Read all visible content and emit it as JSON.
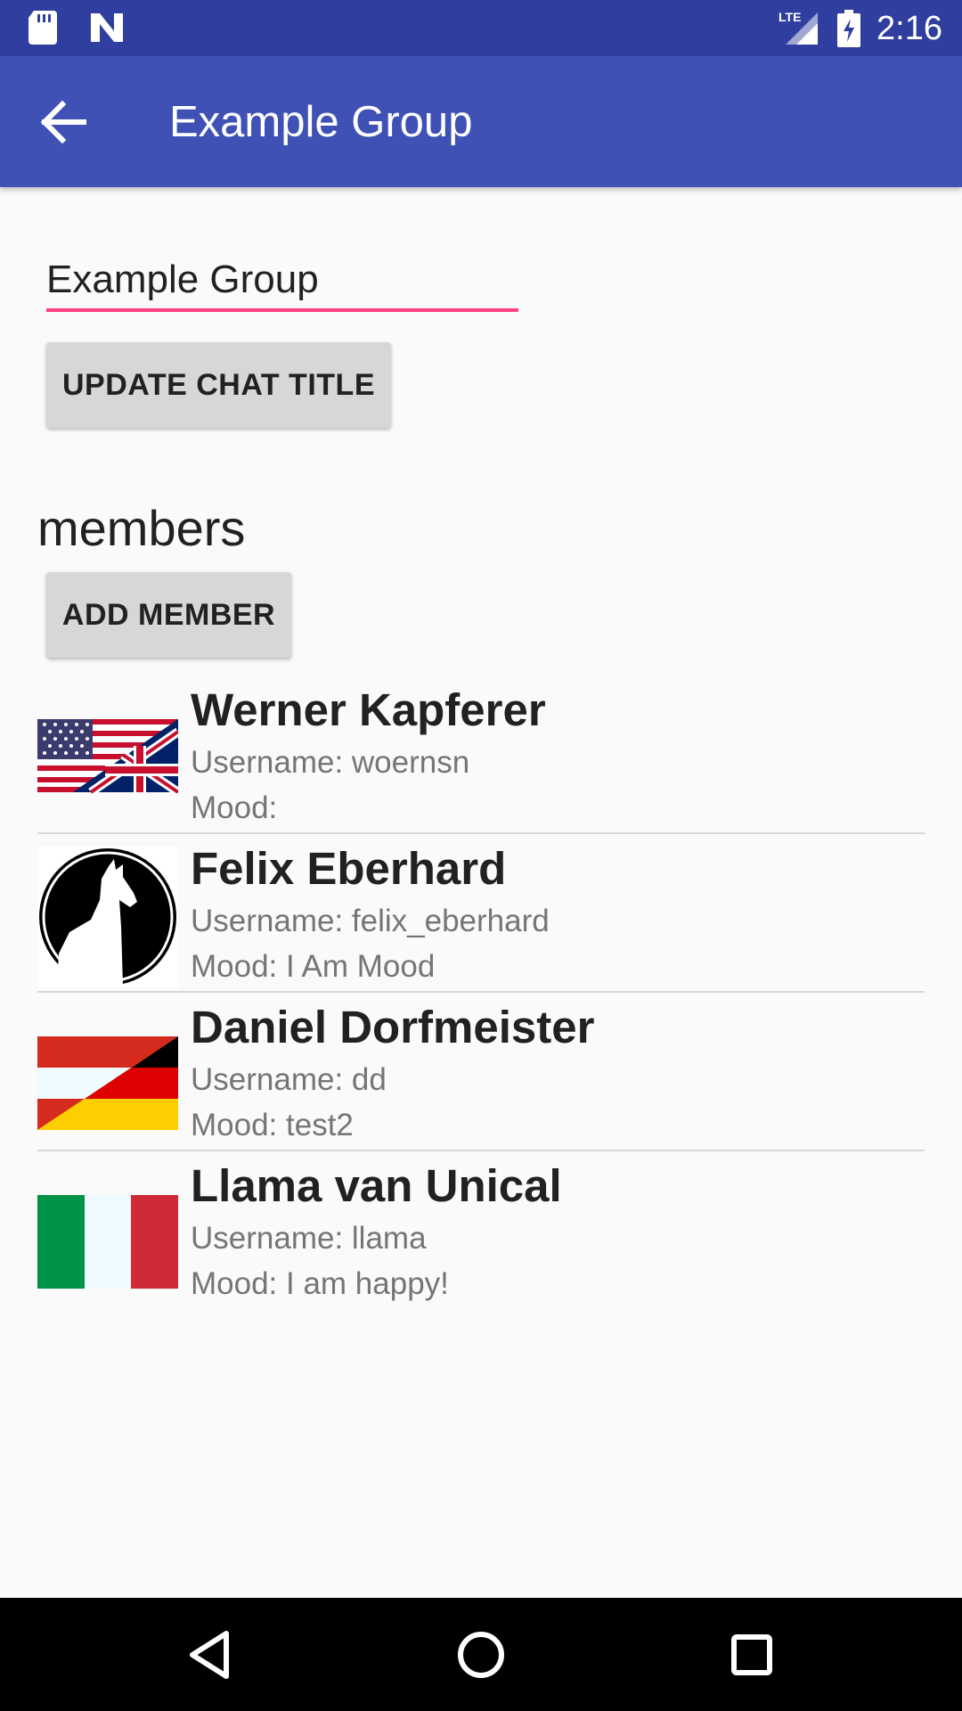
{
  "status_bar": {
    "time": "2:16",
    "network": "LTE",
    "left_icons": [
      "sd-card-icon",
      "n-logo-icon"
    ],
    "right_icons": [
      "signal-icon",
      "battery-icon"
    ]
  },
  "app_bar": {
    "title": "Example Group",
    "back_icon": "arrow-back-icon",
    "color": "#3f51b5",
    "status_color": "#303f9f"
  },
  "chat_title_field": {
    "value": "Example Group",
    "accent": "#ff4081"
  },
  "buttons": {
    "update_title": "UPDATE CHAT TITLE",
    "add_member": "ADD MEMBER"
  },
  "members_section": {
    "title": "members",
    "items": [
      {
        "name": "Werner Kapferer",
        "username": "Username: woernsn",
        "mood": "Mood:",
        "avatar": "us-uk-flag"
      },
      {
        "name": "Felix Eberhard",
        "username": "Username: felix_eberhard",
        "mood": "Mood: I Am Mood",
        "avatar": "llama-logo"
      },
      {
        "name": "Daniel Dorfmeister",
        "username": "Username: dd",
        "mood": "Mood: test2",
        "avatar": "austria-germany-flag"
      },
      {
        "name": "Llama van Unical",
        "username": "Username: llama",
        "mood": "Mood: I am happy!",
        "avatar": "italy-flag"
      }
    ]
  },
  "nav_bar": {
    "buttons": [
      "back-triangle-icon",
      "home-circle-icon",
      "recents-square-icon"
    ]
  }
}
